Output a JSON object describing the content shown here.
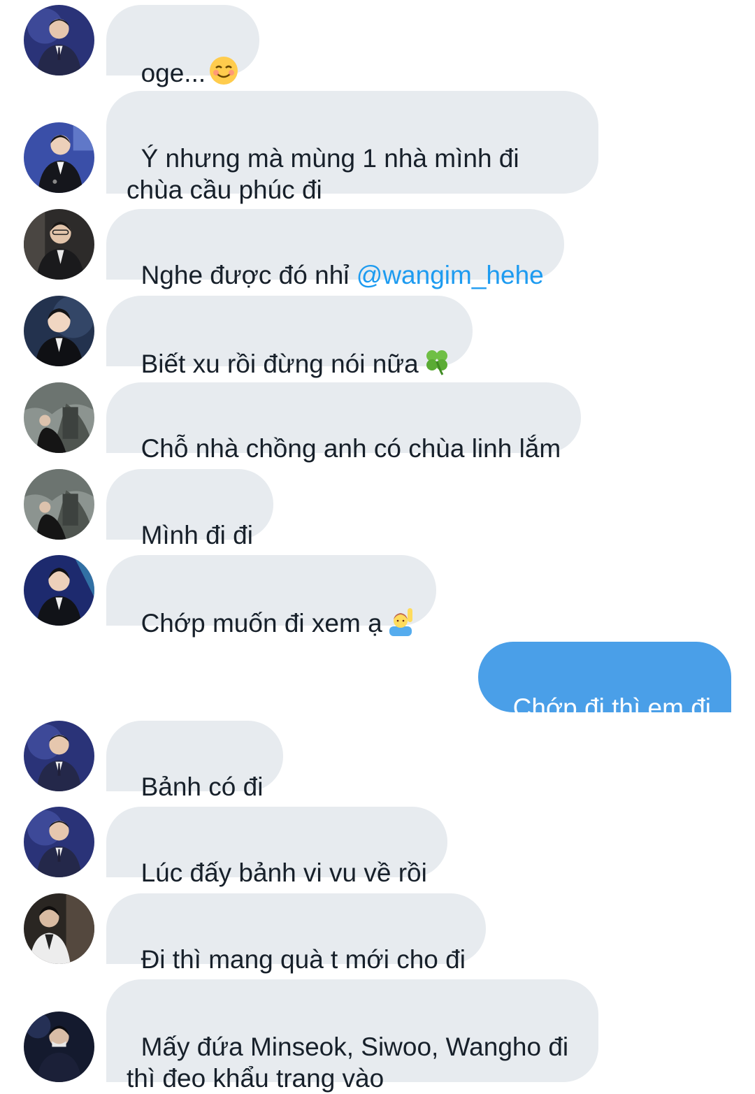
{
  "messages": [
    {
      "id": "m1",
      "text": "oge...",
      "emoji": "smiling-face-icon"
    },
    {
      "id": "m2",
      "text": "Ý nhưng mà mùng 1 nhà mình đi\nchùa cầu phúc đi"
    },
    {
      "id": "m3",
      "text": "Nghe được đó nhỉ ",
      "mention": "@wangim_hehe"
    },
    {
      "id": "m4",
      "text": "Biết xu rồi đừng nói nữa",
      "emoji": "four-leaf-clover-icon"
    },
    {
      "id": "m5",
      "text": "Chỗ nhà chồng anh có chùa linh lắm"
    },
    {
      "id": "m6",
      "text": "Mình đi đi"
    },
    {
      "id": "m7",
      "text": "Chớp muốn đi xem ạ",
      "emoji": "person-raising-hand-icon"
    },
    {
      "id": "m8",
      "text": "Chớp đi thì em đi",
      "outgoing": true
    },
    {
      "id": "m9",
      "text": "Bảnh có đi"
    },
    {
      "id": "m10",
      "text": "Lúc đấy bảnh vi vu về rồi"
    },
    {
      "id": "m11",
      "text": "Đi thì mang quà t mới cho đi"
    },
    {
      "id": "m12",
      "text": "Mấy đứa Minseok, Siwoo, Wangho đi\nthì đeo khẩu trang vào"
    }
  ],
  "colors": {
    "incoming_bubble": "#e7ebef",
    "outgoing_bubble": "#4a9fe8",
    "text": "#17202a",
    "mention": "#1d9bf0"
  }
}
